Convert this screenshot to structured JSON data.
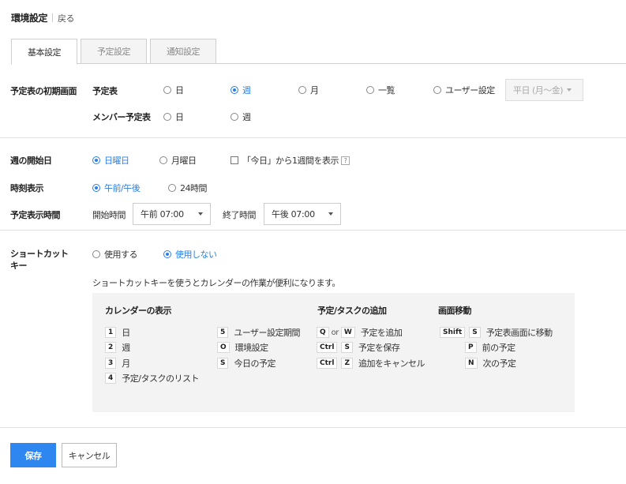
{
  "header": {
    "title": "環境設定",
    "back_label": "戻る"
  },
  "tabs": [
    {
      "label": "基本設定",
      "active": true
    },
    {
      "label": "予定設定",
      "active": false
    },
    {
      "label": "通知設定",
      "active": false
    }
  ],
  "initial_view": {
    "label": "予定表の初期画面",
    "schedule": {
      "label": "予定表",
      "options": [
        "日",
        "週",
        "月",
        "一覧",
        "ユーザー設定"
      ],
      "selected": "週",
      "user_setting_select": "平日 (月～金)"
    },
    "member_schedule": {
      "label": "メンバー予定表",
      "options": [
        "日",
        "週"
      ],
      "selected": null
    }
  },
  "week_start": {
    "label": "週の開始日",
    "options": [
      "日曜日",
      "月曜日"
    ],
    "selected": "日曜日",
    "checkbox_label": "「今日」から1週間を表示",
    "checkbox_checked": false,
    "help_glyph": "?"
  },
  "time_display": {
    "label": "時刻表示",
    "options": [
      "午前/午後",
      "24時間"
    ],
    "selected": "午前/午後"
  },
  "schedule_time": {
    "label": "予定表示時間",
    "start_label": "開始時間",
    "start_value": "午前 07:00",
    "end_label": "終了時間",
    "end_value": "午後 07:00"
  },
  "shortcut": {
    "label_line1": "ショートカット",
    "label_line2": "キー",
    "options": [
      "使用する",
      "使用しない"
    ],
    "selected": "使用しない",
    "description": "ショートカットキーを使うとカレンダーの作業が便利になります。",
    "sections": {
      "calendar_view": "カレンダーの表示",
      "add_task": "予定/タスクの追加",
      "navigation": "画面移動"
    },
    "calendar_items": [
      {
        "key": "1",
        "label": "日"
      },
      {
        "key": "2",
        "label": "週"
      },
      {
        "key": "3",
        "label": "月"
      },
      {
        "key": "4",
        "label": "予定/タスクのリスト"
      }
    ],
    "calendar_items_2": [
      {
        "key": "5",
        "label": "ユーザー設定期間"
      },
      {
        "key": "O",
        "label": "環境設定"
      },
      {
        "key": "S",
        "label": "今日の予定"
      }
    ],
    "add_items": [
      {
        "key1": "Q",
        "or": "or",
        "key2": "W",
        "label": "予定を追加"
      },
      {
        "key1": "Ctrl",
        "key2": "S",
        "label": "予定を保存"
      },
      {
        "key1": "Ctrl",
        "key2": "Z",
        "label": "追加をキャンセル"
      }
    ],
    "nav_items": [
      {
        "key1": "Shift",
        "key2": "S",
        "label": "予定表画面に移動"
      },
      {
        "key2": "P",
        "label": "前の予定"
      },
      {
        "key2": "N",
        "label": "次の予定"
      }
    ]
  },
  "footer": {
    "save_label": "保存",
    "cancel_label": "キャンセル"
  },
  "colors": {
    "accent": "#2e86f0",
    "selected_text": "#2a7fe6",
    "shortcut_bg": "#f3f3f3"
  }
}
